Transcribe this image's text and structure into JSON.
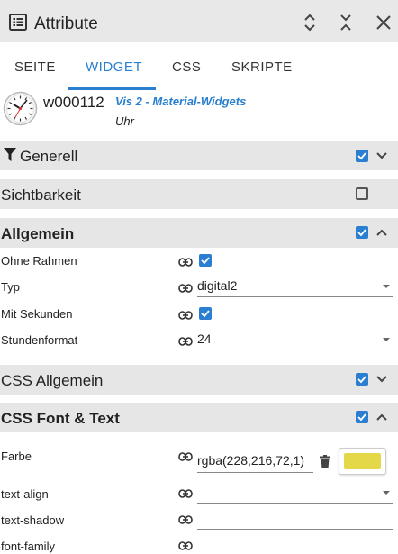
{
  "window": {
    "title": "Attribute",
    "icons": [
      "list-icon",
      "collapse-vertical-icon",
      "expand-vertical-icon",
      "close-icon"
    ]
  },
  "tabs": [
    {
      "label": "SEITE",
      "active": false
    },
    {
      "label": "WIDGET",
      "active": true
    },
    {
      "label": "CSS",
      "active": false
    },
    {
      "label": "SKRIPTE",
      "active": false
    }
  ],
  "widget": {
    "id": "w000112",
    "set": "Vis 2 - Material-Widgets",
    "type": "Uhr",
    "icon": "clock-icon"
  },
  "groups": {
    "generell": {
      "label": "Generell",
      "checked": true,
      "expanded": false
    },
    "sichtbarkeit": {
      "label": "Sichtbarkeit",
      "checked": false
    },
    "allgemein": {
      "label": "Allgemein",
      "checked": true,
      "expanded": true
    },
    "css_allgemein": {
      "label": "CSS Allgemein",
      "checked": true,
      "expanded": false
    },
    "css_font": {
      "label": "CSS Font & Text",
      "checked": true,
      "expanded": true
    }
  },
  "allgemein_rows": {
    "ohne_rahmen": {
      "label": "Ohne Rahmen",
      "checked": true
    },
    "typ": {
      "label": "Typ",
      "value": "digital2"
    },
    "mit_sekunden": {
      "label": "Mit Sekunden",
      "checked": true
    },
    "stundenformat": {
      "label": "Stundenformat",
      "value": "24"
    }
  },
  "font_rows": {
    "farbe": {
      "label": "Farbe",
      "value": "rgba(228,216,72,1)",
      "swatch_color": "#e4d848"
    },
    "text_align": {
      "label": "text-align",
      "value": ""
    },
    "text_shadow": {
      "label": "text-shadow",
      "value": ""
    },
    "font_family": {
      "label": "font-family",
      "value": ""
    }
  },
  "colors": {
    "accent": "#2a7fd0",
    "header_bg": "#e6e6e6"
  }
}
